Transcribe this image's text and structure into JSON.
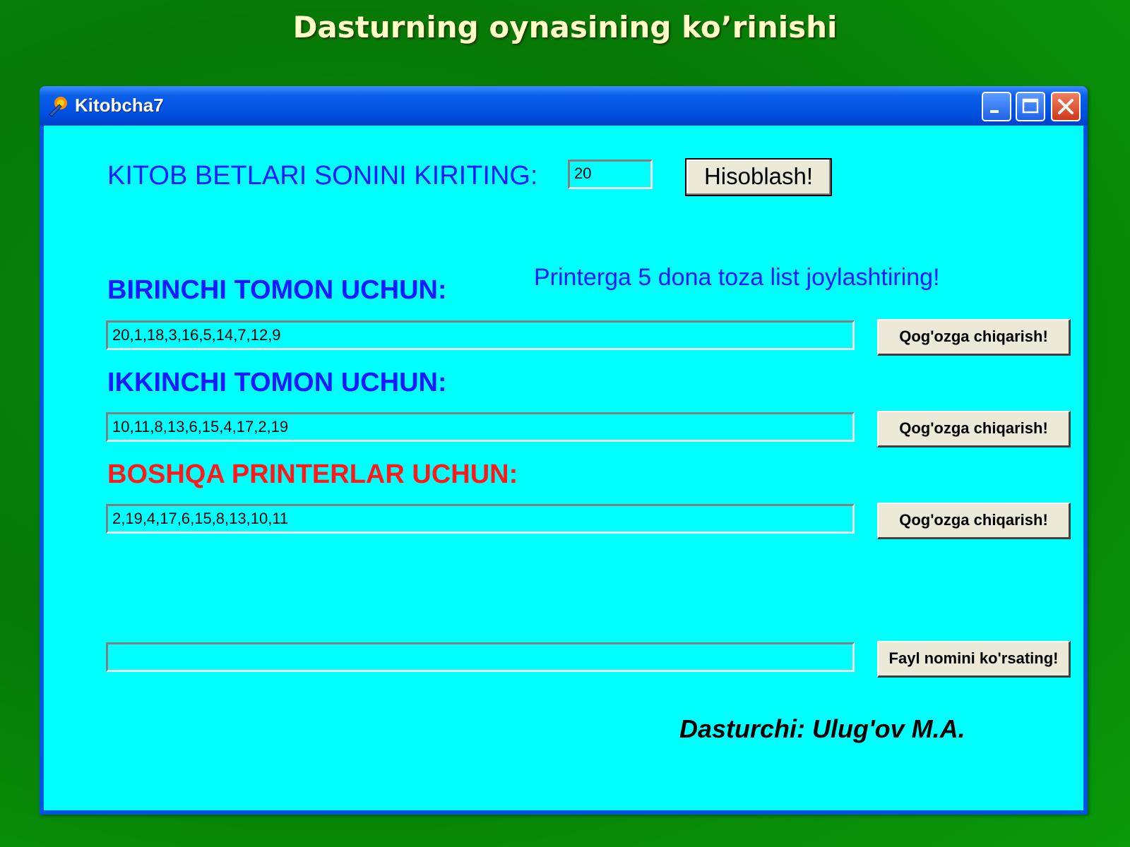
{
  "slide": {
    "title": "Dasturning oynasining ko’rinishi"
  },
  "window": {
    "title": "Kitobcha7",
    "controls": {
      "minimize": "minimize",
      "maximize": "maximize",
      "close": "close"
    }
  },
  "form": {
    "pages_label": "KITOB BETLARI SONINI KIRITING:",
    "pages_value": "20",
    "calc_button": "Hisoblash!",
    "printer_hint": "Printerga 5 dona toza list joylashtiring!",
    "side1_label": "BIRINCHI TOMON UCHUN:",
    "side1_value": "20,1,18,3,16,5,14,7,12,9",
    "side2_label": "IKKINCHI TOMON UCHUN:",
    "side2_value": "10,11,8,13,6,15,4,17,2,19",
    "other_label": "BOSHQA PRINTERLAR UCHUN:",
    "other_value": "2,19,4,17,6,15,8,13,10,11",
    "print_button": "Qog'ozga chiqarish!",
    "file_value": "",
    "file_button": "Fayl nomini ko'rsating!",
    "developer": "Dasturchi: Ulug'ov M.A."
  },
  "colors": {
    "background": "#0a8a0a",
    "client": "#00ffff",
    "label_blue": "#1a1aff",
    "label_red": "#ff1a1a"
  }
}
